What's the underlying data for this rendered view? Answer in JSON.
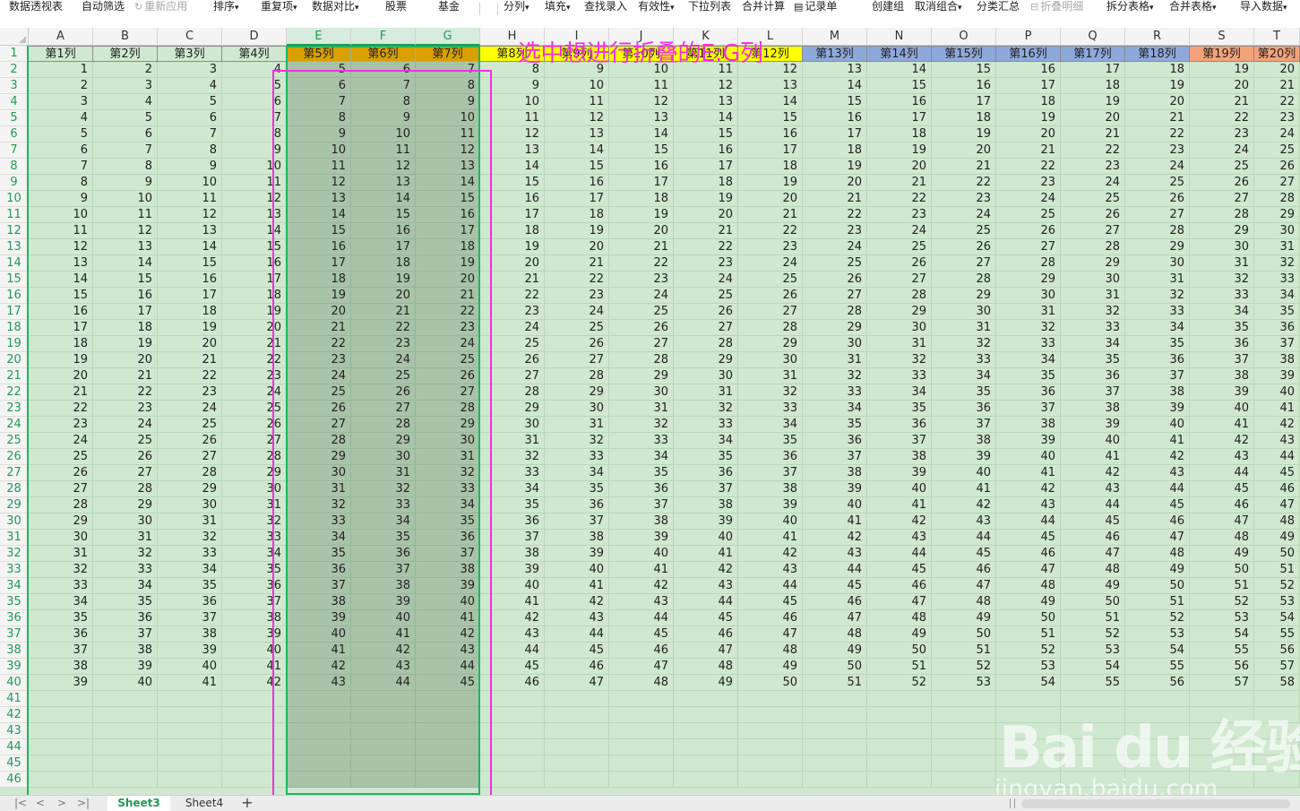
{
  "toolbar": {
    "items": [
      {
        "label": "数据透视表",
        "disabled": false,
        "dropdown": false
      },
      {
        "label": "自动筛选",
        "disabled": false,
        "dropdown": false
      },
      {
        "label": "重新应用",
        "disabled": true,
        "dropdown": false
      },
      {
        "label": "排序",
        "disabled": false,
        "dropdown": true
      },
      {
        "label": "重复项",
        "disabled": false,
        "dropdown": true
      },
      {
        "label": "数据对比",
        "disabled": false,
        "dropdown": true
      },
      {
        "label": "股票",
        "disabled": false,
        "dropdown": false
      },
      {
        "label": "基金",
        "disabled": false,
        "dropdown": false
      },
      {
        "label": "分列",
        "disabled": false,
        "dropdown": true
      },
      {
        "label": "填充",
        "disabled": false,
        "dropdown": true
      },
      {
        "label": "查找录入",
        "disabled": false,
        "dropdown": false
      },
      {
        "label": "有效性",
        "disabled": false,
        "dropdown": true
      },
      {
        "label": "下拉列表",
        "disabled": false,
        "dropdown": false
      },
      {
        "label": "合并计算",
        "disabled": false,
        "dropdown": false
      },
      {
        "label": "记录单",
        "disabled": false,
        "dropdown": false
      },
      {
        "label": "创建组",
        "disabled": false,
        "dropdown": false
      },
      {
        "label": "取消组合",
        "disabled": false,
        "dropdown": true
      },
      {
        "label": "分类汇总",
        "disabled": false,
        "dropdown": false
      },
      {
        "label": "折叠明细",
        "disabled": true,
        "dropdown": false
      },
      {
        "label": "拆分表格",
        "disabled": false,
        "dropdown": true
      },
      {
        "label": "合并表格",
        "disabled": false,
        "dropdown": true
      },
      {
        "label": "导入数据",
        "disabled": false,
        "dropdown": true
      }
    ]
  },
  "annotation": "选中想进行折叠的E:G列",
  "sheet": {
    "column_letters": [
      "A",
      "B",
      "C",
      "D",
      "E",
      "F",
      "G",
      "H",
      "I",
      "J",
      "K",
      "L",
      "M",
      "N",
      "O",
      "P",
      "Q",
      "R",
      "S",
      "T"
    ],
    "selected_columns": [
      "E",
      "F",
      "G"
    ],
    "header_row": [
      "第1列",
      "第2列",
      "第3列",
      "第4列",
      "第5列",
      "第6列",
      "第7列",
      "第8列",
      "第9列",
      "第10列",
      "第11列",
      "第12列",
      "第13列",
      "第14列",
      "第15列",
      "第16列",
      "第17列",
      "第18列",
      "第19列",
      "第20列"
    ],
    "header_colors": [
      "#cfe8cf",
      "#cfe8cf",
      "#cfe8cf",
      "#cfe8cf",
      "#f5b400",
      "#f5b400",
      "#f5b400",
      "#ffff00",
      "#ffff00",
      "#ffff00",
      "#ffff00",
      "#ffff00",
      "#8fa8dc",
      "#8fa8dc",
      "#8fa8dc",
      "#8fa8dc",
      "#8fa8dc",
      "#8fa8dc",
      "#f4a27a",
      "#f4a27a"
    ],
    "row_numbers": [
      1,
      2,
      3,
      4,
      5,
      6,
      7,
      8,
      9,
      10,
      11,
      12,
      13,
      14,
      15,
      16,
      17,
      18,
      19,
      20,
      21,
      22,
      23,
      24,
      25,
      26,
      27,
      28,
      29,
      30,
      31,
      32,
      33,
      34,
      35,
      36,
      37,
      38,
      39,
      40,
      41,
      42,
      43,
      44,
      45,
      46
    ],
    "data_rows": [
      [
        1,
        2,
        3,
        4,
        5,
        6,
        7,
        8,
        9,
        10,
        11,
        12,
        13,
        14,
        15,
        16,
        17,
        18,
        19,
        20
      ],
      [
        2,
        3,
        4,
        5,
        6,
        7,
        8,
        9,
        10,
        11,
        12,
        13,
        14,
        15,
        16,
        17,
        18,
        19,
        20,
        21
      ],
      [
        3,
        4,
        5,
        6,
        7,
        8,
        9,
        10,
        11,
        12,
        13,
        14,
        15,
        16,
        17,
        18,
        19,
        20,
        21,
        22
      ],
      [
        4,
        5,
        6,
        7,
        8,
        9,
        10,
        11,
        12,
        13,
        14,
        15,
        16,
        17,
        18,
        19,
        20,
        21,
        22,
        23
      ],
      [
        5,
        6,
        7,
        8,
        9,
        10,
        11,
        12,
        13,
        14,
        15,
        16,
        17,
        18,
        19,
        20,
        21,
        22,
        23,
        24
      ],
      [
        6,
        7,
        8,
        9,
        10,
        11,
        12,
        13,
        14,
        15,
        16,
        17,
        18,
        19,
        20,
        21,
        22,
        23,
        24,
        25
      ],
      [
        7,
        8,
        9,
        10,
        11,
        12,
        13,
        14,
        15,
        16,
        17,
        18,
        19,
        20,
        21,
        22,
        23,
        24,
        25,
        26
      ],
      [
        8,
        9,
        10,
        11,
        12,
        13,
        14,
        15,
        16,
        17,
        18,
        19,
        20,
        21,
        22,
        23,
        24,
        25,
        26,
        27
      ],
      [
        9,
        10,
        11,
        12,
        13,
        14,
        15,
        16,
        17,
        18,
        19,
        20,
        21,
        22,
        23,
        24,
        25,
        26,
        27,
        28
      ],
      [
        10,
        11,
        12,
        13,
        14,
        15,
        16,
        17,
        18,
        19,
        20,
        21,
        22,
        23,
        24,
        25,
        26,
        27,
        28,
        29
      ],
      [
        11,
        12,
        13,
        14,
        15,
        16,
        17,
        18,
        19,
        20,
        21,
        22,
        23,
        24,
        25,
        26,
        27,
        28,
        29,
        30
      ],
      [
        12,
        13,
        14,
        15,
        16,
        17,
        18,
        19,
        20,
        21,
        22,
        23,
        24,
        25,
        26,
        27,
        28,
        29,
        30,
        31
      ],
      [
        13,
        14,
        15,
        16,
        17,
        18,
        19,
        20,
        21,
        22,
        23,
        24,
        25,
        26,
        27,
        28,
        29,
        30,
        31,
        32
      ],
      [
        14,
        15,
        16,
        17,
        18,
        19,
        20,
        21,
        22,
        23,
        24,
        25,
        26,
        27,
        28,
        29,
        30,
        31,
        32,
        33
      ],
      [
        15,
        16,
        17,
        18,
        19,
        20,
        21,
        22,
        23,
        24,
        25,
        26,
        27,
        28,
        29,
        30,
        31,
        32,
        33,
        34
      ],
      [
        16,
        17,
        18,
        19,
        20,
        21,
        22,
        23,
        24,
        25,
        26,
        27,
        28,
        29,
        30,
        31,
        32,
        33,
        34,
        35
      ],
      [
        17,
        18,
        19,
        20,
        21,
        22,
        23,
        24,
        25,
        26,
        27,
        28,
        29,
        30,
        31,
        32,
        33,
        34,
        35,
        36
      ],
      [
        18,
        19,
        20,
        21,
        22,
        23,
        24,
        25,
        26,
        27,
        28,
        29,
        30,
        31,
        32,
        33,
        34,
        35,
        36,
        37
      ],
      [
        19,
        20,
        21,
        22,
        23,
        24,
        25,
        26,
        27,
        28,
        29,
        30,
        31,
        32,
        33,
        34,
        35,
        36,
        37,
        38
      ],
      [
        20,
        21,
        22,
        23,
        24,
        25,
        26,
        27,
        28,
        29,
        30,
        31,
        32,
        33,
        34,
        35,
        36,
        37,
        38,
        39
      ],
      [
        21,
        22,
        23,
        24,
        25,
        26,
        27,
        28,
        29,
        30,
        31,
        32,
        33,
        34,
        35,
        36,
        37,
        38,
        39,
        40
      ],
      [
        22,
        23,
        24,
        25,
        26,
        27,
        28,
        29,
        30,
        31,
        32,
        33,
        34,
        35,
        36,
        37,
        38,
        39,
        40,
        41
      ],
      [
        23,
        24,
        25,
        26,
        27,
        28,
        29,
        30,
        31,
        32,
        33,
        34,
        35,
        36,
        37,
        38,
        39,
        40,
        41,
        42
      ],
      [
        24,
        25,
        26,
        27,
        28,
        29,
        30,
        31,
        32,
        33,
        34,
        35,
        36,
        37,
        38,
        39,
        40,
        41,
        42,
        43
      ],
      [
        25,
        26,
        27,
        28,
        29,
        30,
        31,
        32,
        33,
        34,
        35,
        36,
        37,
        38,
        39,
        40,
        41,
        42,
        43,
        44
      ],
      [
        26,
        27,
        28,
        29,
        30,
        31,
        32,
        33,
        34,
        35,
        36,
        37,
        38,
        39,
        40,
        41,
        42,
        43,
        44,
        45
      ],
      [
        27,
        28,
        29,
        30,
        31,
        32,
        33,
        34,
        35,
        36,
        37,
        38,
        39,
        40,
        41,
        42,
        43,
        44,
        45,
        46
      ],
      [
        28,
        29,
        30,
        31,
        32,
        33,
        34,
        35,
        36,
        37,
        38,
        39,
        40,
        41,
        42,
        43,
        44,
        45,
        46,
        47
      ],
      [
        29,
        30,
        31,
        32,
        33,
        34,
        35,
        36,
        37,
        38,
        39,
        40,
        41,
        42,
        43,
        44,
        45,
        46,
        47,
        48
      ],
      [
        30,
        31,
        32,
        33,
        34,
        35,
        36,
        37,
        38,
        39,
        40,
        41,
        42,
        43,
        44,
        45,
        46,
        47,
        48,
        49
      ],
      [
        31,
        32,
        33,
        34,
        35,
        36,
        37,
        38,
        39,
        40,
        41,
        42,
        43,
        44,
        45,
        46,
        47,
        48,
        49,
        50
      ],
      [
        32,
        33,
        34,
        35,
        36,
        37,
        38,
        39,
        40,
        41,
        42,
        43,
        44,
        45,
        46,
        47,
        48,
        49,
        50,
        51
      ],
      [
        33,
        34,
        35,
        36,
        37,
        38,
        39,
        40,
        41,
        42,
        43,
        44,
        45,
        46,
        47,
        48,
        49,
        50,
        51,
        52
      ],
      [
        34,
        35,
        36,
        37,
        38,
        39,
        40,
        41,
        42,
        43,
        44,
        45,
        46,
        47,
        48,
        49,
        50,
        51,
        52,
        53
      ],
      [
        35,
        36,
        37,
        38,
        39,
        40,
        41,
        42,
        43,
        44,
        45,
        46,
        47,
        48,
        49,
        50,
        51,
        52,
        53,
        54
      ],
      [
        36,
        37,
        38,
        39,
        40,
        41,
        42,
        43,
        44,
        45,
        46,
        47,
        48,
        49,
        50,
        51,
        52,
        53,
        54,
        55
      ],
      [
        37,
        38,
        39,
        40,
        41,
        42,
        43,
        44,
        45,
        46,
        47,
        48,
        49,
        50,
        51,
        52,
        53,
        54,
        55,
        56
      ],
      [
        38,
        39,
        40,
        41,
        42,
        43,
        44,
        45,
        46,
        47,
        48,
        49,
        50,
        51,
        52,
        53,
        54,
        55,
        56,
        57
      ],
      [
        39,
        40,
        41,
        42,
        43,
        44,
        45,
        46,
        47,
        48,
        49,
        50,
        51,
        52,
        53,
        54,
        55,
        56,
        57,
        58
      ]
    ],
    "cell_background": "#cfe8cf",
    "selection_color": "#a9c3a9",
    "selection_border": "#1fb562"
  },
  "tabs": {
    "sheets": [
      "Sheet3",
      "Sheet4"
    ],
    "active": "Sheet3",
    "add_label": "+"
  },
  "watermark": {
    "logo": "Bai du 经验",
    "url": "jingyan.baidu.com"
  },
  "colors": {
    "accent": "#1f9a55",
    "annotation": "#f030e0"
  }
}
